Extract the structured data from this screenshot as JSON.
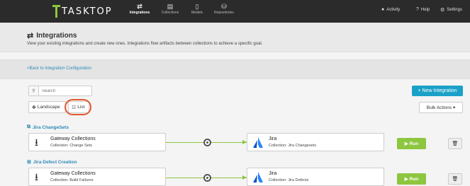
{
  "app": {
    "logo_text": "TASKTOP",
    "nav": [
      {
        "label": "Integrations",
        "icon": "arrows-exchange-icon",
        "glyph": "⇄",
        "active": true
      },
      {
        "label": "Collections",
        "icon": "archive-icon",
        "glyph": "▤",
        "active": false
      },
      {
        "label": "Models",
        "icon": "document-icon",
        "glyph": "▯",
        "active": false
      },
      {
        "label": "Repositories",
        "icon": "database-icon",
        "glyph": "⛁",
        "active": false
      }
    ],
    "right": [
      {
        "label": "Activity",
        "icon": "bell-icon",
        "glyph": "🔔"
      },
      {
        "label": "Help",
        "icon": "help-icon",
        "glyph": "?"
      },
      {
        "label": "Settings",
        "icon": "gear-icon",
        "glyph": "⚙"
      }
    ]
  },
  "header": {
    "title": "Integrations",
    "description": "View your existing integrations and create new ones. Integrations flow artifacts between collections to achieve a specific goal."
  },
  "back_link": "Back to Integration Configuration",
  "toolbar": {
    "search_placeholder": "Search",
    "new_integration_label": "+ New Integration",
    "landscape_label": "Landscape",
    "list_label": "List",
    "bulk_actions_label": "Bulk Actions ▾"
  },
  "integrations": [
    {
      "title": "Jira ChangeSets",
      "source_name": "Gateway Collections",
      "source_collection": "Collection: Change Sets",
      "target_name": "Jira",
      "target_collection": "Collection: Jira Changesets",
      "run_label": "▶ Run",
      "delete_glyph": "🗑"
    },
    {
      "title": "Jira Defect Creation",
      "source_name": "Gateway Collections",
      "source_collection": "Collection: Build Failures",
      "target_name": "Jira",
      "target_collection": "Collection: Jira Defects",
      "run_label": "▶ Run",
      "delete_glyph": "🗑"
    }
  ],
  "colors": {
    "accent_green": "#8dc63f",
    "accent_blue": "#1ba1c7",
    "highlight": "#e2582c",
    "nav_bg": "#2b2b2b"
  }
}
